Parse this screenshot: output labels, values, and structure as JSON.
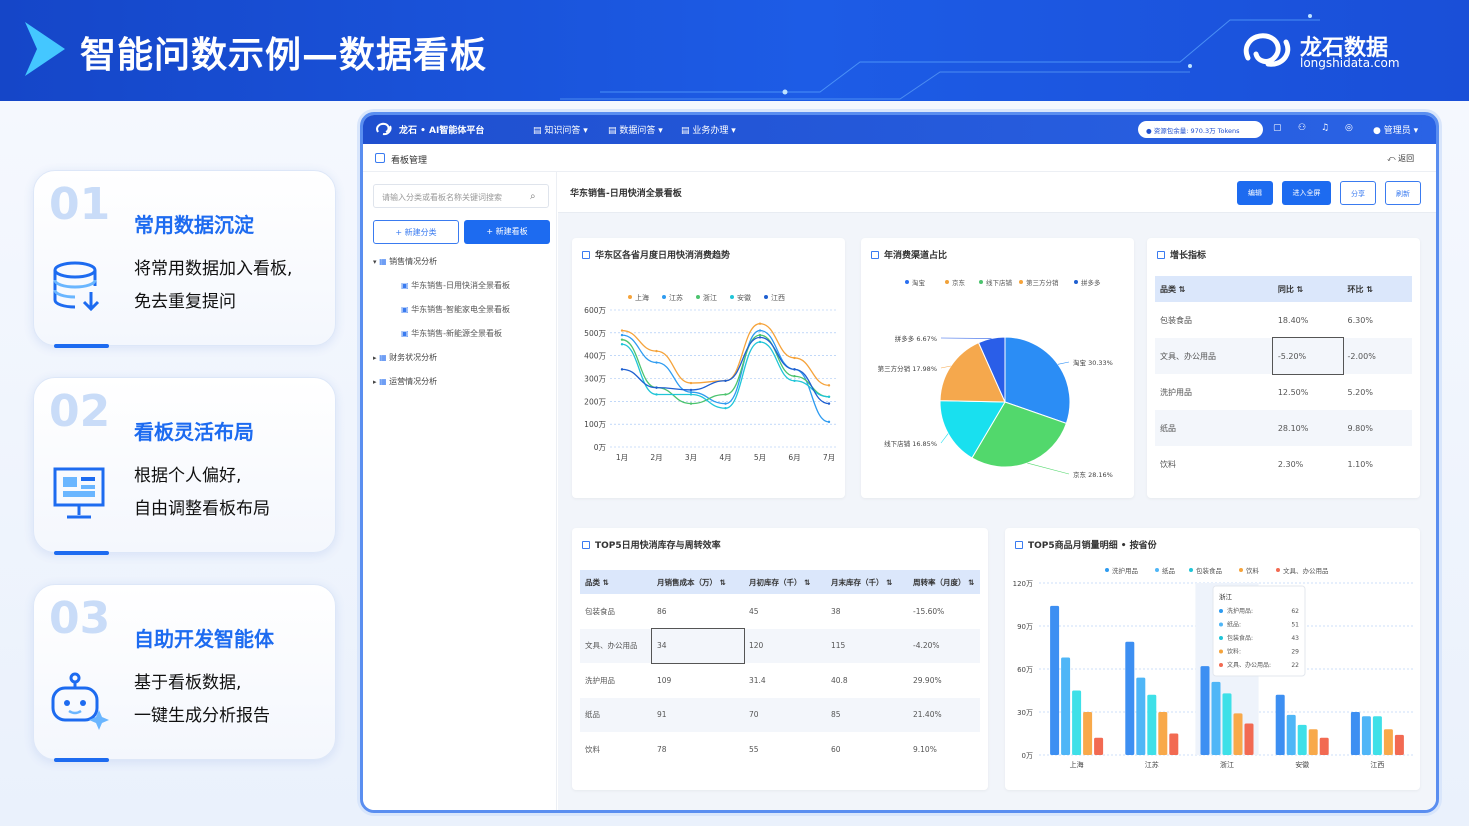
{
  "banner": {
    "title": "智能问数示例—数据看板",
    "logo_name": "龙石数据",
    "logo_url": "longshidata.com"
  },
  "features": [
    {
      "num": "01",
      "title": "常用数据沉淀",
      "line1": "将常用数据加入看板,",
      "line2": "免去重复提问",
      "icon": "database-download-icon"
    },
    {
      "num": "02",
      "title": "看板灵活布局",
      "line1": "根据个人偏好,",
      "line2": "自由调整看板布局",
      "icon": "dashboard-monitor-icon"
    },
    {
      "num": "03",
      "title": "自助开发智能体",
      "line1": "基于看板数据,",
      "line2": "一键生成分析报告",
      "icon": "robot-sparkle-icon"
    }
  ],
  "app": {
    "brand": "龙石 • AI智能体平台",
    "nav": [
      "知识问答",
      "数据问答",
      "业务办理"
    ],
    "tokens": "资源包余量: 970.3万 Tokens",
    "user": "管理员",
    "page_title": "看板管理",
    "back": "返回"
  },
  "sidebar": {
    "search_placeholder": "请输入分类或看板名称关键词搜索",
    "btn_new_category": "+ 新建分类",
    "btn_new_board": "+ 新建看板",
    "groups": [
      {
        "label": "销售情况分析",
        "children": [
          "华东销售-日用快消全景看板",
          "华东销售-智能家电全景看板",
          "华东销售-新能源全景看板"
        ]
      },
      {
        "label": "财务状况分析"
      },
      {
        "label": "运营情况分析"
      }
    ]
  },
  "dashboard": {
    "title": "华东销售-日用快消全景看板",
    "buttons": {
      "edit": "编辑",
      "fullscreen": "进入全屏",
      "share": "分享",
      "refresh": "刷新"
    }
  },
  "colors": {
    "shanghai": "#f5a33b",
    "jiangsu": "#2e9bf0",
    "zhejiang": "#4cc36e",
    "anhui": "#20c5d8",
    "jiangxi": "#1e5fd0",
    "accent": "#1d6bf0"
  },
  "line_chart": {
    "title": "华东区各省月度日用快消消费趋势",
    "chart_data": {
      "type": "line",
      "categories": [
        "1月",
        "2月",
        "3月",
        "4月",
        "5月",
        "6月",
        "7月"
      ],
      "ylabels": [
        "600万",
        "500万",
        "400万",
        "300万",
        "200万",
        "100万",
        "0万"
      ],
      "ylim": [
        0,
        600
      ],
      "series": [
        {
          "name": "上海",
          "values": [
            510,
            420,
            280,
            290,
            540,
            390,
            270
          ]
        },
        {
          "name": "江苏",
          "values": [
            490,
            370,
            240,
            190,
            510,
            340,
            110
          ]
        },
        {
          "name": "浙江",
          "values": [
            470,
            260,
            190,
            230,
            490,
            310,
            220
          ]
        },
        {
          "name": "安徽",
          "values": [
            450,
            230,
            230,
            170,
            460,
            290,
            220
          ]
        },
        {
          "name": "江西",
          "values": [
            340,
            260,
            250,
            290,
            480,
            340,
            190
          ]
        }
      ]
    }
  },
  "pie_chart": {
    "title": "年消费渠道占比",
    "chart_data": {
      "type": "pie",
      "slices": [
        {
          "name": "淘宝",
          "value": 30.33,
          "label": "淘宝 30.33%"
        },
        {
          "name": "京东",
          "value": 28.16,
          "label": "京东 28.16%"
        },
        {
          "name": "线下店铺",
          "value": 16.85,
          "label": "线下店铺 16.85%"
        },
        {
          "name": "第三方分销",
          "value": 17.98,
          "label": "第三方分销 17.98%"
        },
        {
          "name": "拼多多",
          "value": 6.67,
          "label": "拼多多 6.67%"
        }
      ]
    }
  },
  "growth": {
    "title": "增长指标",
    "headers": [
      "品类",
      "同比",
      "环比"
    ],
    "rows": [
      [
        "包装食品",
        "18.40%",
        "6.30%"
      ],
      [
        "文具、办公用品",
        "-5.20%",
        "-2.00%"
      ],
      [
        "洗护用品",
        "12.50%",
        "5.20%"
      ],
      [
        "纸品",
        "28.10%",
        "9.80%"
      ],
      [
        "饮料",
        "2.30%",
        "1.10%"
      ]
    ]
  },
  "inventory": {
    "title": "TOP5日用快消库存与周转效率",
    "headers": [
      "品类",
      "月销售成本（万）",
      "月初库存（千）",
      "月末库存（千）",
      "周转率（月度）"
    ],
    "rows": [
      [
        "包装食品",
        "86",
        "45",
        "38",
        "-15.60%"
      ],
      [
        "文具、办公用品",
        "34",
        "120",
        "115",
        "-4.20%"
      ],
      [
        "洗护用品",
        "109",
        "31.4",
        "40.8",
        "29.90%"
      ],
      [
        "纸品",
        "91",
        "70",
        "85",
        "21.40%"
      ],
      [
        "饮料",
        "78",
        "55",
        "60",
        "9.10%"
      ]
    ]
  },
  "bar_chart": {
    "title": "TOP5商品月销量明细 • 按省份",
    "chart_data": {
      "type": "bar",
      "categories": [
        "上海",
        "江苏",
        "浙江",
        "安徽",
        "江西"
      ],
      "ylabels": [
        "120万",
        "90万",
        "60万",
        "30万",
        "0万"
      ],
      "ylim": [
        0,
        120
      ],
      "series": [
        {
          "name": "洗护用品",
          "values": [
            104,
            79,
            62,
            42,
            30
          ]
        },
        {
          "name": "纸品",
          "values": [
            68,
            54,
            51,
            28,
            27
          ]
        },
        {
          "name": "包装食品",
          "values": [
            45,
            42,
            43,
            21,
            27
          ]
        },
        {
          "name": "饮料",
          "values": [
            30,
            30,
            29,
            18,
            18
          ]
        },
        {
          "name": "文具、办公用品",
          "values": [
            12,
            15,
            22,
            12,
            14
          ]
        }
      ]
    },
    "tooltip": {
      "title": "浙江",
      "items": [
        {
          "name": "洗护用品:",
          "value": "62"
        },
        {
          "name": "纸品:",
          "value": "51"
        },
        {
          "name": "包装食品:",
          "value": "43"
        },
        {
          "name": "饮料:",
          "value": "29"
        },
        {
          "name": "文具、办公用品:",
          "value": "22"
        }
      ]
    }
  }
}
